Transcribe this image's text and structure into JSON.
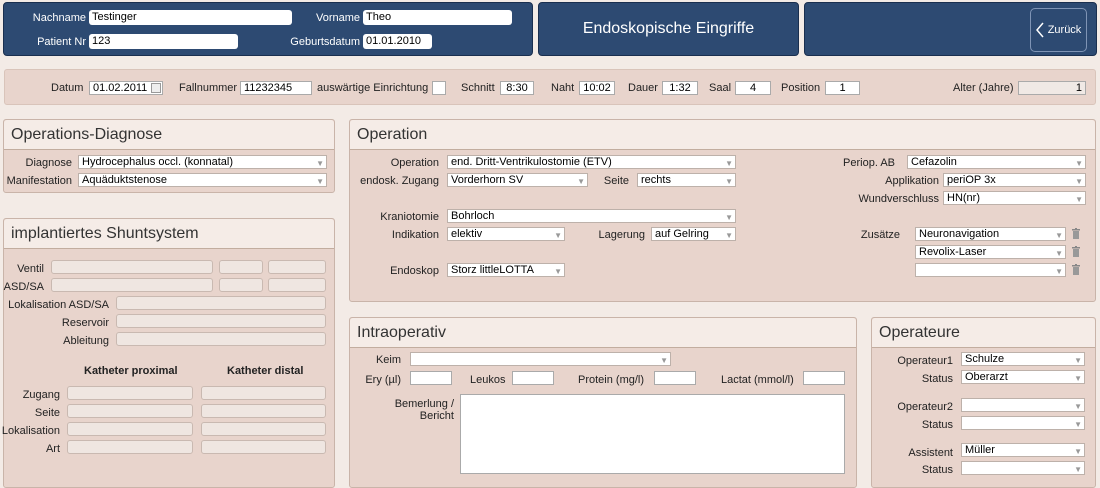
{
  "header": {
    "nachname_label": "Nachname",
    "nachname_value": "Testinger",
    "vorname_label": "Vorname",
    "vorname_value": "Theo",
    "patient_nr_label": "Patient Nr",
    "patient_nr_value": "123",
    "geburtsdatum_label": "Geburtsdatum",
    "geburtsdatum_value": "01.01.2010",
    "title": "Endoskopische Eingriffe",
    "back_label": "Zurück"
  },
  "infobar": {
    "datum_label": "Datum",
    "datum_value": "01.02.2011",
    "fallnummer_label": "Fallnummer",
    "fallnummer_value": "11232345",
    "auswaertig_label": "auswärtige Einrichtung",
    "schnitt_label": "Schnitt",
    "schnitt_value": "8:30",
    "naht_label": "Naht",
    "naht_value": "10:02",
    "dauer_label": "Dauer",
    "dauer_value": "1:32",
    "saal_label": "Saal",
    "saal_value": "4",
    "position_label": "Position",
    "position_value": "1",
    "alter_label": "Alter (Jahre)",
    "alter_value": "1"
  },
  "diagnose": {
    "title": "Operations-Diagnose",
    "diagnose_label": "Diagnose",
    "diagnose_value": "Hydrocephalus  occl. (konnatal)",
    "manifestation_label": "Manifestation",
    "manifestation_value": "Aquäduktstenose"
  },
  "shunt": {
    "title": "implantiertes Shuntsystem",
    "ventil_label": "Ventil",
    "asd_label": "ASD/SA",
    "lokalisation_asd_label": "Lokalisation ASD/SA",
    "reservoir_label": "Reservoir",
    "ableitung_label": "Ableitung",
    "katheter_proximal": "Katheter proximal",
    "katheter_distal": "Katheter distal",
    "zugang_label": "Zugang",
    "seite_label": "Seite",
    "lokalisation_label": "Lokalisation",
    "art_label": "Art"
  },
  "operation": {
    "title": "Operation",
    "operation_label": "Operation",
    "operation_value": "end. Dritt-Ventrikulostomie (ETV)",
    "zugang_label": "endosk. Zugang",
    "zugang_value": "Vorderhorn SV",
    "seite_label": "Seite",
    "seite_value": "rechts",
    "kraniotomie_label": "Kraniotomie",
    "kraniotomie_value": "Bohrloch",
    "indikation_label": "Indikation",
    "indikation_value": "elektiv",
    "lagerung_label": "Lagerung",
    "lagerung_value": "auf Gelring",
    "endoskop_label": "Endoskop",
    "endoskop_value": "Storz littleLOTTA",
    "periop_label": "Periop. AB",
    "periop_value": "Cefazolin",
    "applikation_label": "Applikation",
    "applikation_value": "periOP 3x",
    "wundverschluss_label": "Wundverschluss",
    "wundverschluss_value": "HN(nr)",
    "zusaetze_label": "Zusätze",
    "zusaetze_values": [
      "Neuronavigation",
      "Revolix-Laser",
      ""
    ]
  },
  "intraop": {
    "title": "Intraoperativ",
    "keim_label": "Keim",
    "ery_label": "Ery (µl)",
    "leukos_label": "Leukos",
    "protein_label": "Protein (mg/l)",
    "lactat_label": "Lactat (mmol/l)",
    "bemerlung_label": "Bemerlung /",
    "bericht_label": "Bericht"
  },
  "operateure": {
    "title": "Operateure",
    "operateur1_label": "Operateur1",
    "operateur1_value": "Schulze",
    "status1_label": "Status",
    "status1_value": "Oberarzt",
    "operateur2_label": "Operateur2",
    "operateur2_value": "",
    "status2_label": "Status",
    "status2_value": "",
    "assistent_label": "Assistent",
    "assistent_value": "Müller",
    "status3_label": "Status",
    "status3_value": ""
  }
}
